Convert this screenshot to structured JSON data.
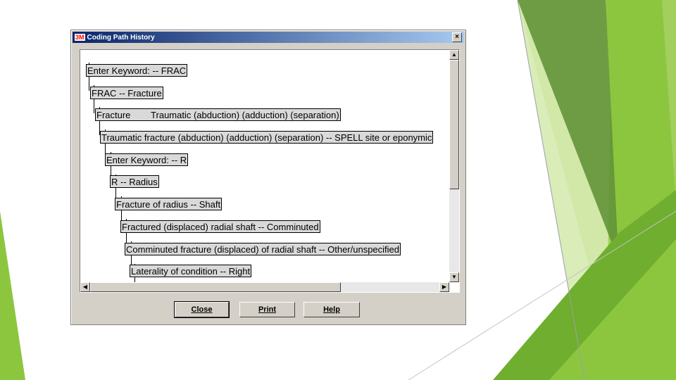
{
  "dialog": {
    "logo": "3M",
    "title": "Coding Path History",
    "close_symbol": "×"
  },
  "tree": [
    "Enter Keyword:  -- FRAC",
    "FRAC --  Fracture",
    "Fracture        Traumatic (abduction) (adduction) (separation)",
    "Traumatic fracture (abduction) (adduction) (separation) --  SPELL site or eponymic",
    "Enter Keyword: -- R",
    "R --  Radius",
    "Fracture of radius --  Shaft",
    "Fractured (displaced) radial shaft --  Comminuted",
    "Comminuted fracture (displaced) of radial shaft --  Other/unspecified",
    "Laterality of condition --  Right"
  ],
  "buttons": {
    "close": "Close",
    "print": "Print",
    "help": "Help"
  },
  "theme": {
    "green_dark": "#5a8f2a",
    "green_mid": "#7bbf3a",
    "green_light": "#c8e39a",
    "title_bar": "#0a246a",
    "dialog_bg": "#d4d0c8"
  }
}
